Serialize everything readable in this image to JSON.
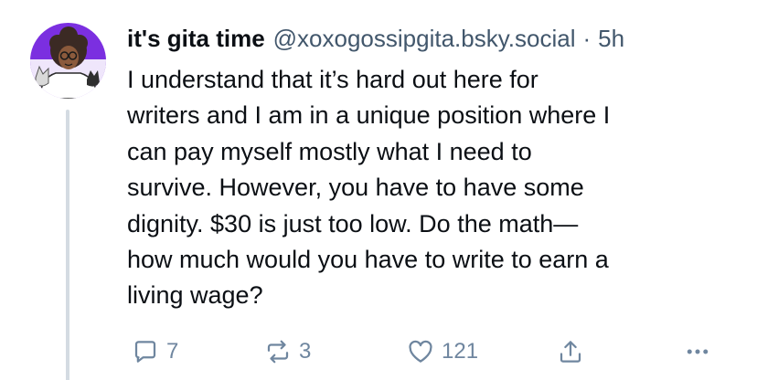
{
  "post": {
    "display_name": "it's gita time",
    "handle": "@xoxogossipgita.bsky.social",
    "separator": "·",
    "time": "5h",
    "text_lines": [
      "I understand that it’s hard out here for",
      "writers and I am in a unique position where I",
      "can pay myself mostly what I need to",
      "survive. However, you have to have some",
      "dignity. $30 is just too low. Do the math—",
      "how much would you have to write to earn a",
      "living wage?"
    ]
  },
  "actions": {
    "reply": {
      "icon": "reply-icon",
      "count": "7"
    },
    "repost": {
      "icon": "repost-icon",
      "count": "3"
    },
    "like": {
      "icon": "heart-icon",
      "count": "121"
    },
    "share": {
      "icon": "share-icon"
    },
    "more": {
      "icon": "more-icon"
    }
  },
  "colors": {
    "text": "#0b0f14",
    "muted": "#42576c",
    "icon": "#6f869f",
    "thread_line": "#d4dbe2",
    "avatar_bg": "#7b2fe0"
  }
}
